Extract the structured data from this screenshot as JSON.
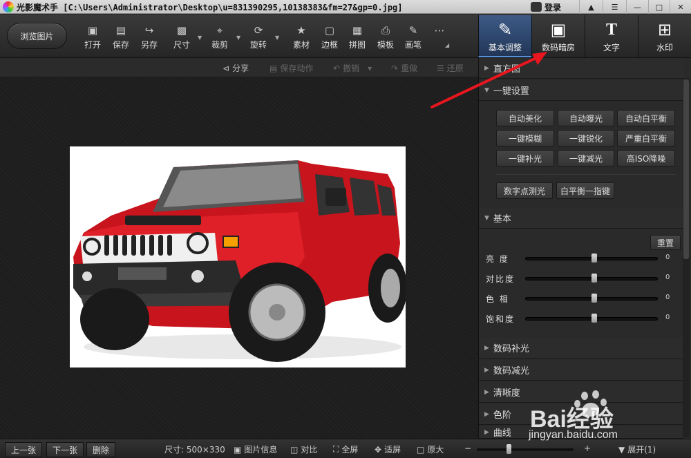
{
  "titlebar": {
    "title": "光影魔术手 [C:\\Users\\Administrator\\Desktop\\u=831390295,10138383&fm=27&gp=0.jpg]",
    "login": "登录"
  },
  "toolbar": {
    "browse": "浏览图片",
    "tools": [
      {
        "label": "打开",
        "icon": "open-icon"
      },
      {
        "label": "保存",
        "icon": "save-icon"
      },
      {
        "label": "另存",
        "icon": "save-as-icon"
      },
      {
        "label": "尺寸",
        "icon": "resize-icon"
      },
      {
        "label": "裁剪",
        "icon": "crop-icon"
      },
      {
        "label": "旋转",
        "icon": "rotate-icon"
      },
      {
        "label": "素材",
        "icon": "material-icon"
      },
      {
        "label": "边框",
        "icon": "frame-icon"
      },
      {
        "label": "拼图",
        "icon": "collage-icon"
      },
      {
        "label": "模板",
        "icon": "template-icon"
      },
      {
        "label": "画笔",
        "icon": "brush-icon"
      }
    ],
    "right_tabs": [
      {
        "label": "基本调整",
        "icon": "adjust-icon"
      },
      {
        "label": "数码暗房",
        "icon": "darkroom-icon"
      },
      {
        "label": "文字",
        "icon": "text-icon"
      },
      {
        "label": "水印",
        "icon": "watermark-icon"
      }
    ]
  },
  "subbar": {
    "share": "分享",
    "save_action": "保存动作",
    "undo": "撤销",
    "redo": "重做",
    "restore": "还原"
  },
  "panel": {
    "histogram": "直方图",
    "oneclick": "一键设置",
    "oneclick_buttons": [
      "自动美化",
      "自动曝光",
      "自动白平衡",
      "一键模糊",
      "一键锐化",
      "严重白平衡",
      "一键补光",
      "一键减光",
      "高ISO降噪"
    ],
    "extra_buttons": [
      "数字点测光",
      "白平衡一指键"
    ],
    "basic": "基本",
    "reset": "重置",
    "sliders": [
      {
        "label": "亮 度",
        "value": "0"
      },
      {
        "label": "对比度",
        "value": "0"
      },
      {
        "label": "色 相",
        "value": "0"
      },
      {
        "label": "饱和度",
        "value": "0"
      }
    ],
    "sections": [
      "数码补光",
      "数码减光",
      "清晰度",
      "色阶",
      "曲线"
    ]
  },
  "statusbar": {
    "prev": "上一张",
    "next": "下一张",
    "delete": "删除",
    "size": "尺寸: 500×330",
    "info": "图片信息",
    "compare": "对比",
    "fullscreen": "全屏",
    "fit": "适屏",
    "original": "原大",
    "expand": "展开(1)"
  },
  "watermark": {
    "brand": "Bai经验",
    "url": "jingyan.baidu.com"
  }
}
